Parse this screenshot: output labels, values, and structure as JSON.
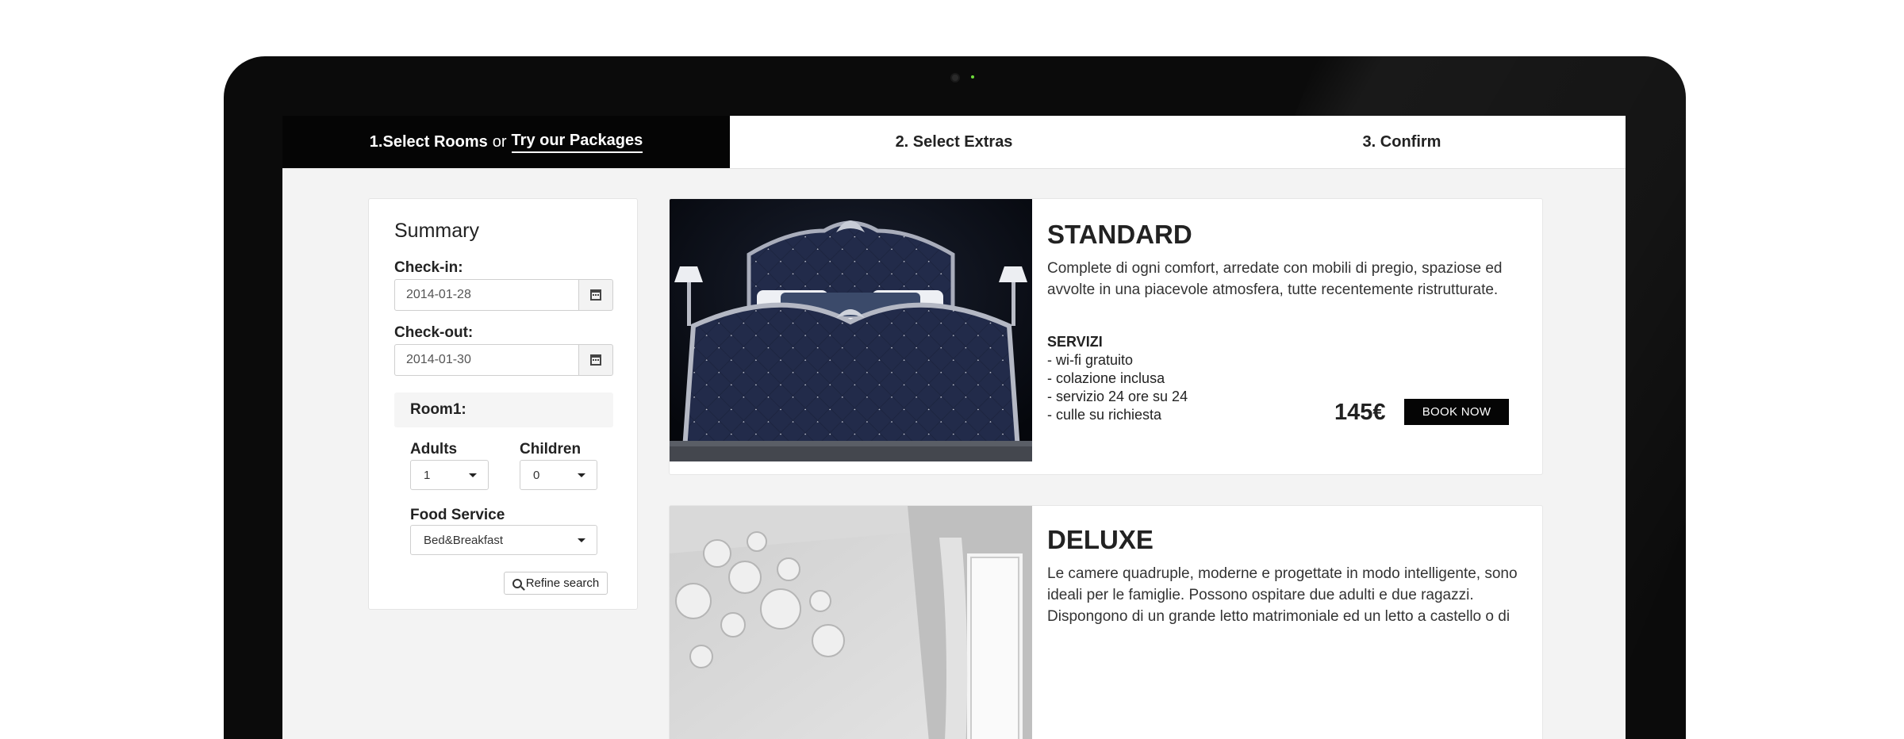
{
  "steps": {
    "step1_prefix": "1.Select Rooms",
    "step1_or": "or",
    "step1_packages": "Try our Packages",
    "step2": "2. Select Extras",
    "step3": "3. Confirm"
  },
  "summary": {
    "title": "Summary",
    "checkin_label": "Check-in:",
    "checkin_value": "2014-01-28",
    "checkout_label": "Check-out:",
    "checkout_value": "2014-01-30",
    "room_label": "Room1:",
    "adults_label": "Adults",
    "adults_value": "1",
    "children_label": "Children",
    "children_value": "0",
    "food_label": "Food Service",
    "food_value": "Bed&Breakfast",
    "refine_label": "Refine search"
  },
  "rooms": [
    {
      "title": "STANDARD",
      "description": "Complete di ogni comfort, arredate con mobili di pregio, spaziose ed avvolte in una piacevole atmosfera, tutte recentemente ristrutturate.",
      "services_heading": "SERVIZI",
      "services": [
        "- wi-fi gratuito",
        "- colazione inclusa",
        "- servizio 24 ore su 24",
        "- culle su richiesta"
      ],
      "price": "145€",
      "book_label": "BOOK NOW"
    },
    {
      "title": "DELUXE",
      "description": "Le camere quadruple, moderne e progettate in modo intelligente, sono ideali per le famiglie. Possono ospitare due adulti e due ragazzi. Dispongono di un grande letto matrimoniale ed un letto a castello o di"
    }
  ]
}
